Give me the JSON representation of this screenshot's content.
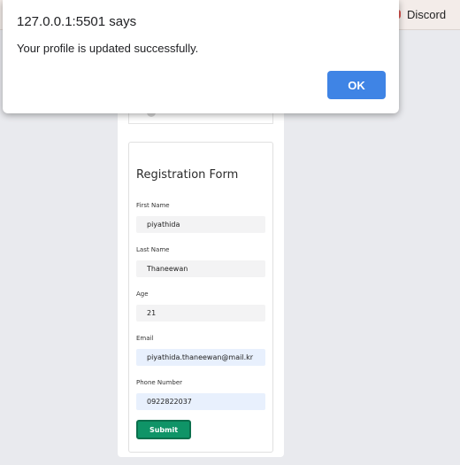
{
  "browser": {
    "bookmark_label": "Discord"
  },
  "dialog": {
    "title": "127.0.0.1:5501 says",
    "message": "Your profile is updated successfully.",
    "ok_label": "OK"
  },
  "form": {
    "title": "Registration Form",
    "fields": [
      {
        "label": "First Name",
        "value": "piyathida"
      },
      {
        "label": "Last Name",
        "value": "Thaneewan"
      },
      {
        "label": "Age",
        "value": "21"
      },
      {
        "label": "Email",
        "value": "piyathida.thaneewan@mail.kr"
      },
      {
        "label": "Phone Number",
        "value": "0922822037"
      }
    ],
    "submit_label": "Submit"
  },
  "colors": {
    "submit": "#0f9467",
    "ok": "#3f84e5"
  }
}
